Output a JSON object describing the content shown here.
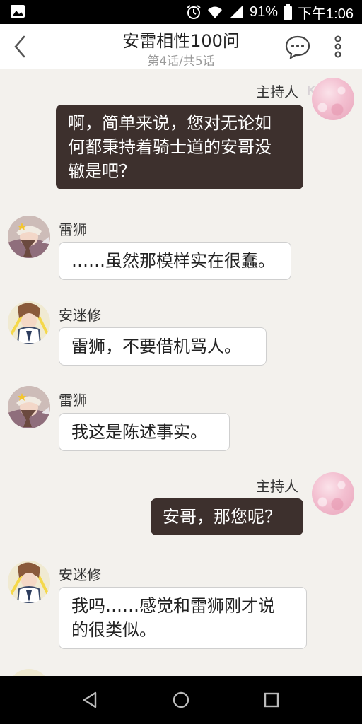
{
  "status_bar": {
    "battery": "91%",
    "time": "下午1:06",
    "icons": [
      "image-icon",
      "alarm-icon",
      "wifi-icon",
      "signal-icon",
      "battery-icon"
    ]
  },
  "header": {
    "title": "安雷相性100问",
    "subtitle": "第4话/共5话",
    "icons": [
      "back-chevron-icon",
      "comment-icon",
      "more-vertical-icon"
    ]
  },
  "chat": {
    "watermark": "K",
    "messages": [
      {
        "speaker": "主持人",
        "side": "right",
        "text_lines": [
          "啊，简单来说，您对无论如",
          "何都秉持着骑士道的安哥没",
          "辙是吧？"
        ]
      },
      {
        "speaker": "雷狮",
        "side": "left",
        "text_lines": [
          "……虽然那模样实在很蠢。"
        ]
      },
      {
        "speaker": "安迷修",
        "side": "left",
        "text_lines": [
          "雷狮，不要借机骂人。"
        ]
      },
      {
        "speaker": "雷狮",
        "side": "left",
        "text_lines": [
          "我这是陈述事实。"
        ]
      },
      {
        "speaker": "主持人",
        "side": "right",
        "text_lines": [
          "安哥，那您呢？"
        ]
      },
      {
        "speaker": "安迷修",
        "side": "left",
        "text_lines": [
          "我吗……感觉和雷狮刚才说",
          "的很类似。"
        ]
      }
    ]
  },
  "nav_bar": {
    "icons": [
      "back-triangle-icon",
      "home-circle-icon",
      "recents-square-icon"
    ]
  },
  "colors": {
    "background": "#f3f1ed",
    "dark_bubble": "#3d302d",
    "light_bubble": "#ffffff"
  }
}
